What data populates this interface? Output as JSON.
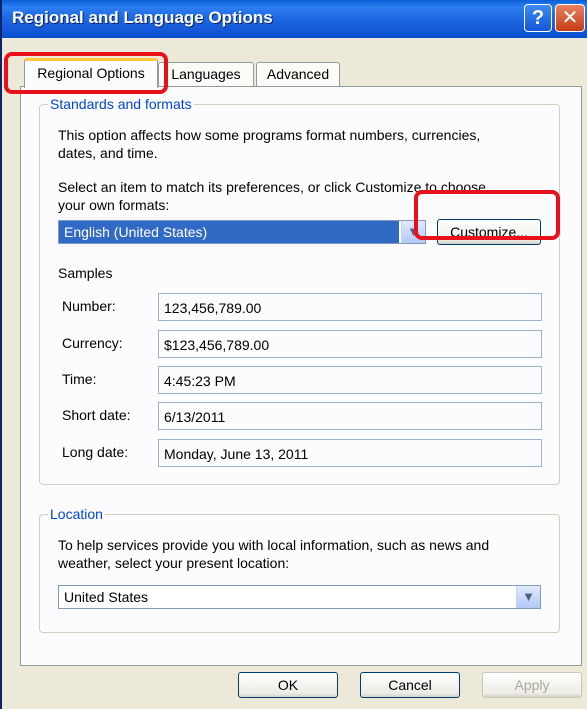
{
  "window": {
    "title": "Regional and Language Options"
  },
  "title_buttons": {
    "help": "?",
    "close": "✕"
  },
  "tabs": [
    {
      "label": "Regional Options"
    },
    {
      "label": "Languages"
    },
    {
      "label": "Advanced"
    }
  ],
  "standards": {
    "group_label": "Standards and formats",
    "description_line1": "This option affects how some programs format numbers, currencies,",
    "description_line2": "dates, and time.",
    "instruction_line1": "Select an item to match its preferences, or click Customize to choose",
    "instruction_line2": "your own formats:",
    "selected_format": "English (United States)",
    "customize_button": "Customize...",
    "samples_heading": "Samples",
    "samples": [
      {
        "label": "Number:",
        "value": "123,456,789.00"
      },
      {
        "label": "Currency:",
        "value": "$123,456,789.00"
      },
      {
        "label": "Time:",
        "value": "4:45:23 PM"
      },
      {
        "label": "Short date:",
        "value": "6/13/2011"
      },
      {
        "label": "Long date:",
        "value": "Monday, June 13, 2011"
      }
    ]
  },
  "location": {
    "group_label": "Location",
    "description_line1": "To help services provide you with local information, such as news and",
    "description_line2": "weather, select your present location:",
    "selected_location": "United States"
  },
  "buttons": {
    "ok": "OK",
    "cancel": "Cancel",
    "apply": "Apply"
  },
  "icons": {
    "dropdown": "chevron-down-icon",
    "help": "question-icon",
    "close": "close-icon"
  },
  "colors": {
    "title_bar": "#1b63e0",
    "highlight": "#e8101a",
    "selection": "#316ac5",
    "group_label": "#0046d5"
  }
}
